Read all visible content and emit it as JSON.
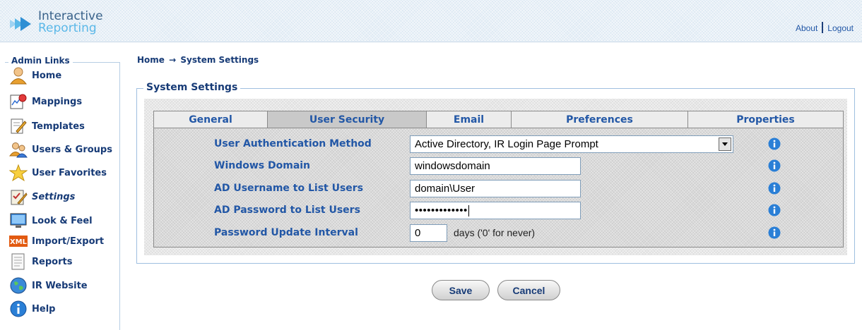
{
  "header": {
    "logo_line1": "Interactive",
    "logo_line2": "Reporting",
    "about_link": "About",
    "logout_link": "Logout"
  },
  "sidebar": {
    "title": "Admin Links",
    "items": [
      {
        "label": "Home",
        "icon": "home-user-icon"
      },
      {
        "label": "Mappings",
        "icon": "mappings-icon"
      },
      {
        "label": "Templates",
        "icon": "templates-icon"
      },
      {
        "label": "Users & Groups",
        "icon": "users-groups-icon"
      },
      {
        "label": "User Favorites",
        "icon": "star-icon"
      },
      {
        "label": "Settings",
        "icon": "settings-icon",
        "active": true
      },
      {
        "label": "Look & Feel",
        "icon": "monitor-icon"
      },
      {
        "label": "Import/Export",
        "icon": "xml-icon"
      },
      {
        "label": "Reports",
        "icon": "reports-icon"
      },
      {
        "label": "IR Website",
        "icon": "globe-icon"
      },
      {
        "label": "Help",
        "icon": "help-icon"
      }
    ]
  },
  "breadcrumb": {
    "home": "Home",
    "arrow": "→",
    "current": "System Settings"
  },
  "settings": {
    "title": "System Settings",
    "tabs": [
      {
        "label": "General"
      },
      {
        "label": "User Security",
        "active": true
      },
      {
        "label": "Email"
      },
      {
        "label": "Preferences"
      },
      {
        "label": "Properties"
      }
    ],
    "rows": {
      "auth_method": {
        "label": "User Authentication Method",
        "value": "Active Directory, IR Login Page Prompt"
      },
      "windows_domain": {
        "label": "Windows Domain",
        "value": "windowsdomain"
      },
      "ad_username": {
        "label": "AD Username to List Users",
        "value": "domain\\User"
      },
      "ad_password": {
        "label": "AD Password to List Users",
        "value": "•••••••••••••"
      },
      "pw_interval": {
        "label": "Password Update Interval",
        "value": "0",
        "suffix": "days ('0' for never)"
      }
    }
  },
  "buttons": {
    "save": "Save",
    "cancel": "Cancel"
  },
  "colors": {
    "nav_text": "#163a76",
    "label_blue": "#2257a6",
    "info_blue": "#2a7fd6"
  }
}
